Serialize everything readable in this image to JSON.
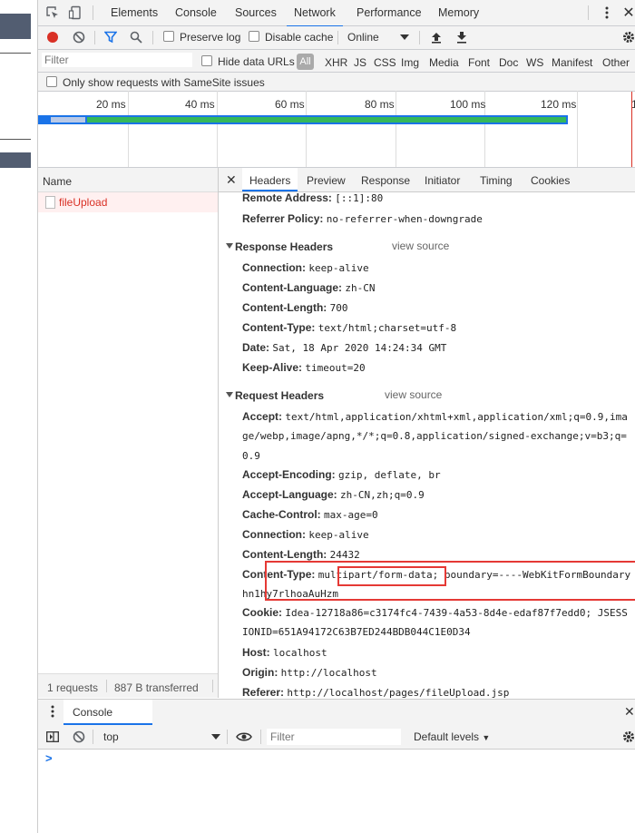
{
  "main_tabs": [
    "Elements",
    "Console",
    "Sources",
    "Network",
    "Performance",
    "Memory"
  ],
  "toolbar": {
    "preserve_log": "Preserve log",
    "disable_cache": "Disable cache",
    "throttle": "Online"
  },
  "filter_bar": {
    "placeholder": "Filter",
    "hide_data_urls": "Hide data URLs",
    "types": [
      "All",
      "XHR",
      "JS",
      "CSS",
      "Img",
      "Media",
      "Font",
      "Doc",
      "WS",
      "Manifest",
      "Other"
    ],
    "samesite": "Only show requests with SameSite issues"
  },
  "timeline": {
    "ticks": [
      "20 ms",
      "40 ms",
      "60 ms",
      "80 ms",
      "100 ms",
      "120 ms"
    ]
  },
  "requests": {
    "header": "Name",
    "items": [
      "fileUpload"
    ],
    "status": "1 requests",
    "transferred": "887 B transferred"
  },
  "details_tabs": [
    "Headers",
    "Preview",
    "Response",
    "Initiator",
    "Timing",
    "Cookies"
  ],
  "general": [
    {
      "name": "Remote Address:",
      "value": "[::1]:80"
    },
    {
      "name": "Referrer Policy:",
      "value": "no-referrer-when-downgrade"
    }
  ],
  "response_headers": {
    "title": "Response Headers",
    "view_source": "view source",
    "items": [
      {
        "name": "Connection:",
        "value": "keep-alive"
      },
      {
        "name": "Content-Language:",
        "value": "zh-CN"
      },
      {
        "name": "Content-Length:",
        "value": "700"
      },
      {
        "name": "Content-Type:",
        "value": "text/html;charset=utf-8"
      },
      {
        "name": "Date:",
        "value": "Sat, 18 Apr 2020 14:24:34 GMT"
      },
      {
        "name": "Keep-Alive:",
        "value": "timeout=20"
      }
    ]
  },
  "request_headers": {
    "title": "Request Headers",
    "view_source": "view source",
    "accept_name": "Accept:",
    "accept_lines": [
      "text/html,application/xhtml+xml,application/xml;q=0.9,ima",
      "ge/webp,image/apng,*/*;q=0.8,application/signed-exchange;v=b3;q=",
      "0.9"
    ],
    "accept_encoding_name": "Accept-Encoding:",
    "accept_encoding": "gzip, deflate, br",
    "accept_language_name": "Accept-Language:",
    "accept_language": "zh-CN,zh;q=0.9",
    "cache_control_name": "Cache-Control:",
    "cache_control": "max-age=0",
    "connection_name": "Connection:",
    "connection": "keep-alive",
    "content_length_name": "Content-Length:",
    "content_length": "24432",
    "content_type_name": "Content-Type:",
    "content_type_lines": [
      "multipart/form-data; boundary=----WebKitFormBoundary",
      "hn1hy7rlhoaAuHzm"
    ],
    "cookie_name": "Cookie:",
    "cookie_lines": [
      "Idea-12718a86=c3174fc4-7439-4a53-8d4e-edaf87f7edd0; JSESS",
      "IONID=651A94172C63B7ED244BDB044C1E0D34"
    ],
    "host_name": "Host:",
    "host": "localhost",
    "origin_name": "Origin:",
    "origin": "http://localhost",
    "referer_name": "Referer:",
    "referer": "http://localhost/pages/fileUpload.jsp"
  },
  "console_drawer": {
    "tab": "Console",
    "context": "top",
    "filter_placeholder": "Filter",
    "levels": "Default levels",
    "prompt": ">"
  }
}
